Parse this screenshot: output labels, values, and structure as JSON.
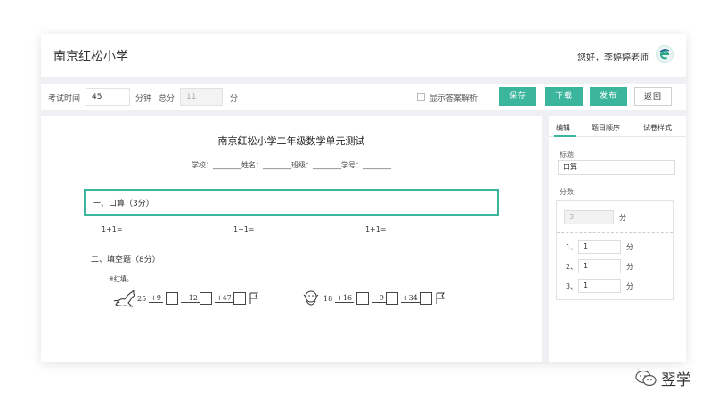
{
  "header": {
    "school_title": "南京红松小学",
    "greeting": "您好，李婷婷老师",
    "avatar_icon": "e-logo-icon"
  },
  "toolbar": {
    "exam_time_label": "考试时间",
    "exam_time_value": "45",
    "minute_label": "分钟",
    "total_label": "总分",
    "total_value": "11",
    "score_unit": "分",
    "show_answer_label": "显示答案解析",
    "save": "保存",
    "download": "下载",
    "publish": "发布",
    "back": "返回"
  },
  "paper": {
    "title": "南京红松小学二年级数学单元测试",
    "info_line": "学校：________姓名：________班级：________学号：________",
    "section1_title": "一、口算（3分）",
    "equations": [
      "1+1=",
      "1+1=",
      "1+1="
    ],
    "section2_title": "二、填空题（8分）",
    "hint": "※红填。",
    "chain1": {
      "start": "25",
      "ops": [
        "+9",
        "−12",
        "+47"
      ]
    },
    "chain2": {
      "start": "18",
      "ops": [
        "+16",
        "−9",
        "+34"
      ]
    }
  },
  "sidebar": {
    "tabs": [
      "编辑",
      "题目顺序",
      "试卷样式"
    ],
    "title_label": "标题",
    "title_value": "口算",
    "score_label": "分数",
    "total_score": "3",
    "unit": "分",
    "items": [
      {
        "index": "1、",
        "value": "1"
      },
      {
        "index": "2、",
        "value": "1"
      },
      {
        "index": "3、",
        "value": "1"
      }
    ]
  },
  "watermark": {
    "text": "翌学",
    "icon": "wechat-icon"
  },
  "colors": {
    "accent": "#3bb59b"
  }
}
